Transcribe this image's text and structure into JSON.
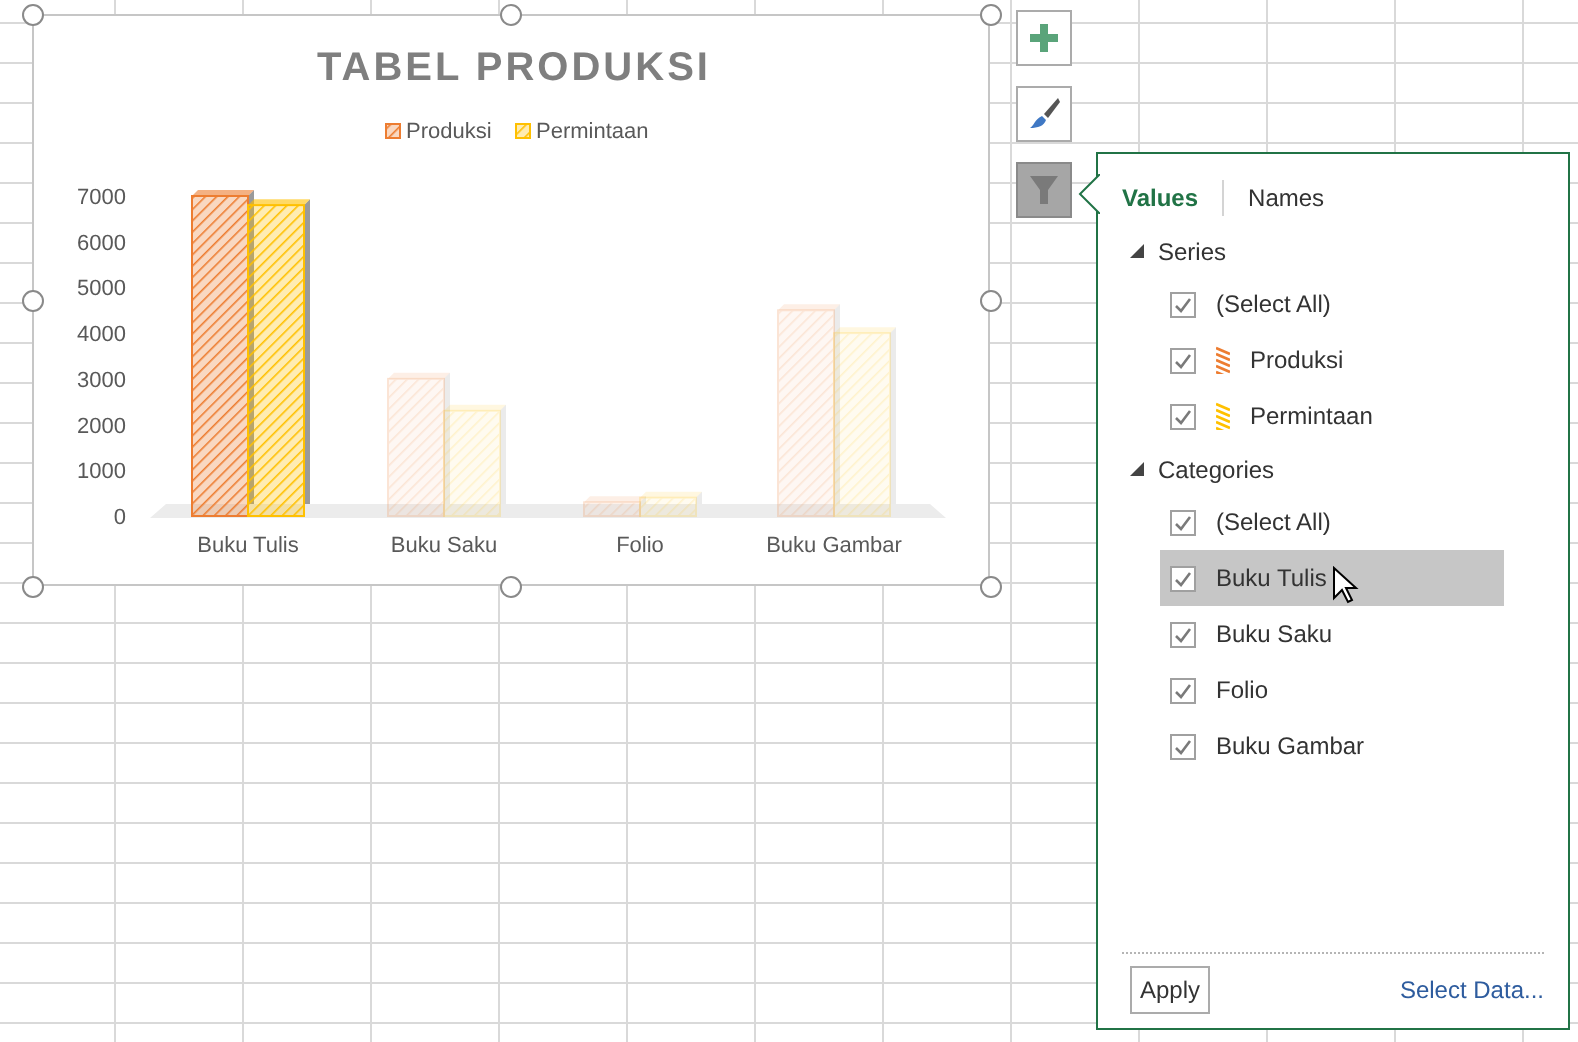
{
  "chart": {
    "chart_data": {
      "type": "bar",
      "title": "TABEL PRODUKSI",
      "categories": [
        "Buku Tulis",
        "Buku Saku",
        "Folio",
        "Buku Gambar"
      ],
      "series": [
        {
          "name": "Produksi",
          "color": "#ed7d31",
          "values": [
            7000,
            3000,
            300,
            4500
          ]
        },
        {
          "name": "Permintaan",
          "color": "#ffc000",
          "values": [
            6800,
            2300,
            400,
            4000
          ]
        }
      ],
      "legend": "top",
      "ylim": [
        0,
        7000
      ],
      "yticks": [
        0,
        1000,
        2000,
        3000,
        4000,
        5000,
        6000,
        7000
      ]
    }
  },
  "chart_buttons": [
    {
      "kind": "add",
      "selected": false
    },
    {
      "kind": "style",
      "selected": false
    },
    {
      "kind": "filter",
      "selected": true
    }
  ],
  "filter_panel": {
    "tabs": [
      {
        "label": "Values",
        "selected": true
      },
      {
        "label": "Names",
        "selected": false
      }
    ],
    "sections": [
      {
        "label": "Series",
        "expanded": true,
        "items": [
          {
            "kind": "select_all",
            "label": "(Select All)",
            "checked": true,
            "hovered": false
          },
          {
            "kind": "series",
            "label": "Produksi",
            "checked": true,
            "hovered": false,
            "color": "#ed7d31"
          },
          {
            "kind": "series",
            "label": "Permintaan",
            "checked": true,
            "hovered": false,
            "color": "#ffc000"
          }
        ]
      },
      {
        "label": "Categories",
        "expanded": true,
        "items": [
          {
            "kind": "select_all",
            "label": "(Select All)",
            "checked": true,
            "hovered": false
          },
          {
            "kind": "category",
            "label": "Buku Tulis",
            "checked": true,
            "hovered": true
          },
          {
            "kind": "category",
            "label": "Buku Saku",
            "checked": true,
            "hovered": false
          },
          {
            "kind": "category",
            "label": "Folio",
            "checked": true,
            "hovered": false
          },
          {
            "kind": "category",
            "label": "Buku Gambar",
            "checked": true,
            "hovered": false
          }
        ]
      }
    ],
    "apply_button": "Apply",
    "link": "Select Data..."
  }
}
